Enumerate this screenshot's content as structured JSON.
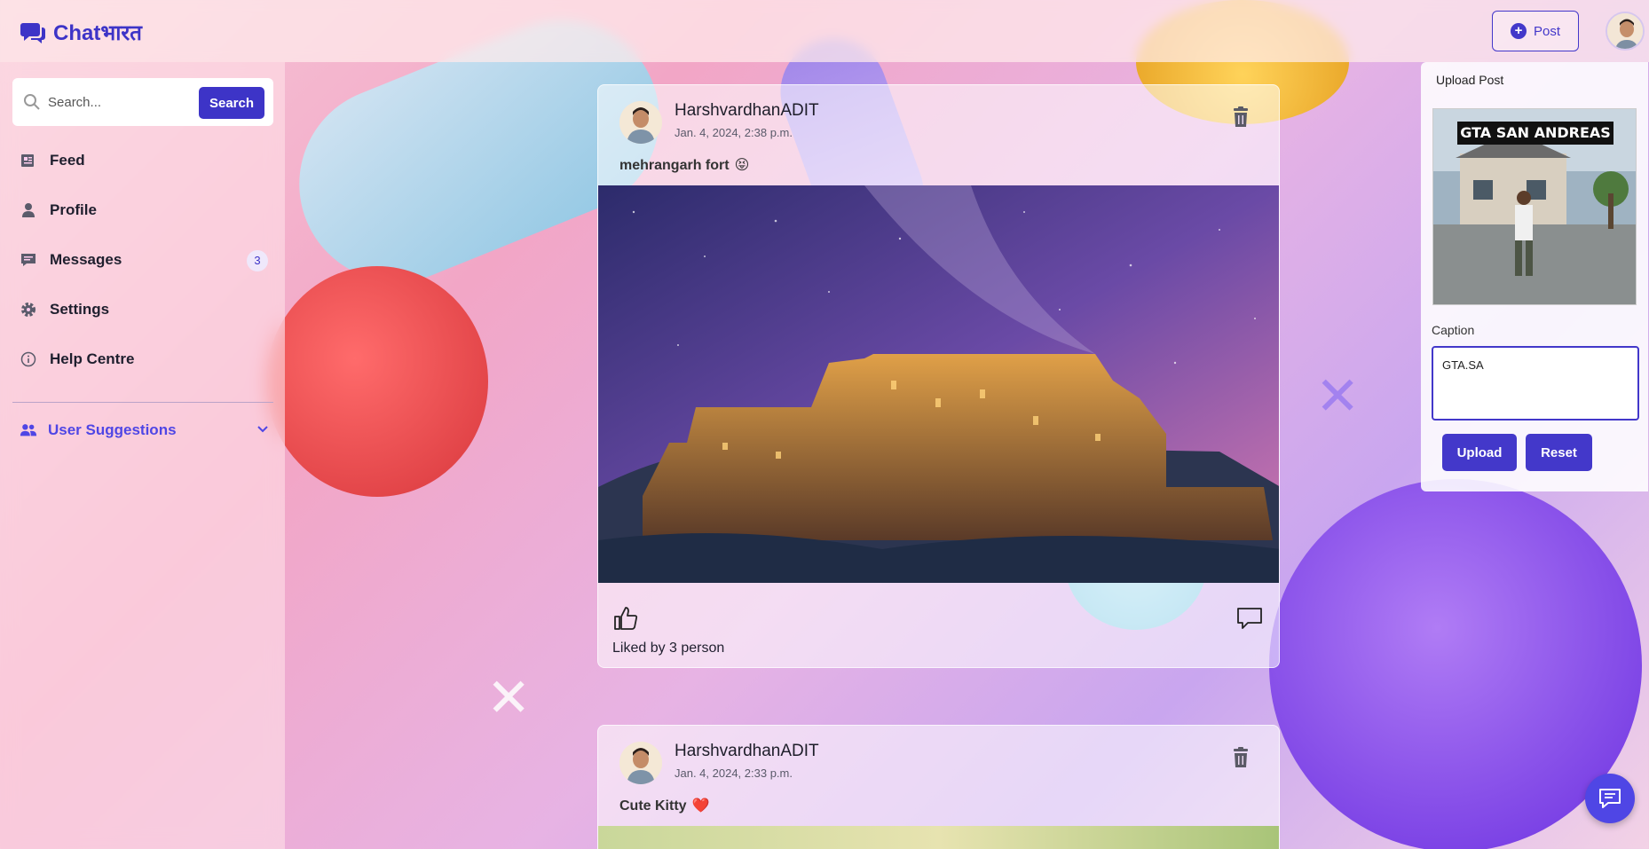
{
  "app": {
    "name": "Chatभारत"
  },
  "header": {
    "post_label": "Post"
  },
  "sidebar": {
    "search_placeholder": "Search...",
    "search_button": "Search",
    "items": [
      {
        "label": "Feed",
        "icon": "newspaper-icon"
      },
      {
        "label": "Profile",
        "icon": "user-icon"
      },
      {
        "label": "Messages",
        "icon": "message-icon",
        "badge": "3"
      },
      {
        "label": "Settings",
        "icon": "gear-icon"
      },
      {
        "label": "Help Centre",
        "icon": "info-icon"
      }
    ],
    "suggestions_label": "User Suggestions"
  },
  "posts": [
    {
      "author": "HarshvardhanADIT",
      "timestamp": "Jan. 4, 2024, 2:38 p.m.",
      "text": "mehrangarh fort",
      "emoji": "😝",
      "likes": "Liked by 3 person"
    },
    {
      "author": "HarshvardhanADIT",
      "timestamp": "Jan. 4, 2024, 2:33 p.m.",
      "text": "Cute Kitty",
      "emoji": "❤️"
    }
  ],
  "upload": {
    "title": "Upload Post",
    "image_text": "GTA SAN ANDREAS",
    "caption_label": "Caption",
    "caption_value": "GTA.SA",
    "upload_button": "Upload",
    "reset_button": "Reset"
  },
  "colors": {
    "accent": "#4338ca",
    "brand": "#3d34c7"
  }
}
